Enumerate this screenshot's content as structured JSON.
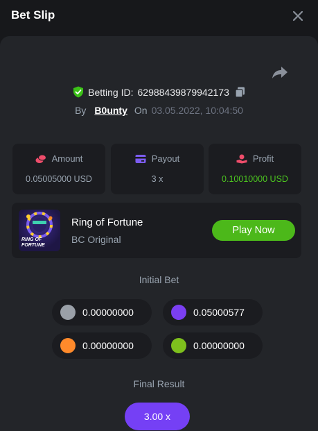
{
  "header": {
    "title": "Bet Slip"
  },
  "bet": {
    "id_label": "Betting ID:",
    "id_value": "62988439879942173",
    "by_label": "By",
    "user": "B0unty",
    "on_label": "On",
    "date": "03.05.2022, 10:04:50"
  },
  "stats": [
    {
      "label": "Amount",
      "value": "0.05005000 USD",
      "icon": "coins-icon",
      "color": "#ef4d6b"
    },
    {
      "label": "Payout",
      "value": "3 x",
      "icon": "card-icon",
      "color": "#7c5cf0"
    },
    {
      "label": "Profit",
      "value": "0.10010000 USD",
      "icon": "profit-hand-icon",
      "color": "#ef4d6b"
    }
  ],
  "game": {
    "name": "Ring of Fortune",
    "provider": "BC Original",
    "play_label": "Play Now",
    "thumb_text": "RING OF FORTUNE"
  },
  "initial_bet": {
    "title": "Initial Bet",
    "items": [
      {
        "color": "#9aa0a8",
        "value": "0.00000000"
      },
      {
        "color": "#7b3ff2",
        "value": "0.05000577"
      },
      {
        "color": "#ff8a2b",
        "value": "0.00000000"
      },
      {
        "color": "#7ec01d",
        "value": "0.00000000"
      }
    ]
  },
  "final_result": {
    "title": "Final Result",
    "value": "3.00 x"
  },
  "colors": {
    "accent_green": "#4cb81a",
    "accent_purple": "#7540f5",
    "profit_green": "#4cc51f"
  }
}
